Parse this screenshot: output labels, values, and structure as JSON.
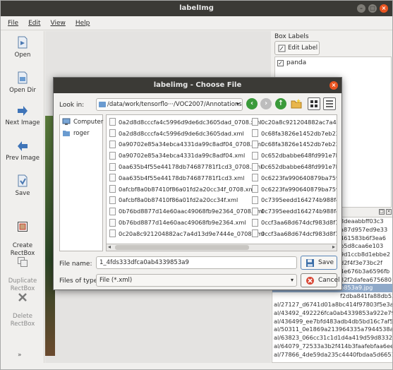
{
  "window": {
    "title": "labelImg"
  },
  "menu": {
    "items": [
      "File",
      "Edit",
      "View",
      "Help"
    ]
  },
  "toolbar": {
    "open": "Open",
    "open_dir": "Open Dir",
    "next_image": "Next Image",
    "prev_image": "Prev Image",
    "save": "Save",
    "create_rectbox": "Create\nRectBox",
    "duplicate_rectbox": "Duplicate\nRectBox",
    "delete_rectbox": "Delete\nRectBox",
    "more": "»"
  },
  "dock": {
    "title": "Box Labels",
    "edit_label": "Edit Label",
    "labels": [
      {
        "name": "panda",
        "checked": true
      }
    ],
    "file_list": [
      "8deaabbff03c3",
      "a87d957ed9e33",
      "461583b6f3ea6",
      "b5d8caa6e103",
      "9d1ccb8d1ebbe2",
      "d2f4f3e73bc2f",
      "4e676b3a6596fb",
      "32f2dafea675680",
      "b853a9.jpg",
      "f2dba841fa88db52",
      "al/27127_d6741d01a8bc414f97803f5e3a5",
      "al/43492_492226fca0ab4339853a922e79e",
      "al/436499_ee7bfd483adb4db5bd16c7af51",
      "al/50311_0e1869a213964335a7944538a8",
      "al/63823_066cc31c1d1d4a419d59d8332b",
      "al/64079_72533a3b2f414b3faafebfaa6ee",
      "al/77866_4de59da235c4440fbdaa5d6651"
    ],
    "selected_file_index": 8
  },
  "dialog": {
    "title": "labelimg - Choose File",
    "look_in_label": "Look in:",
    "look_in_value": "/data/work/tensorflo···/VOC2007/Annotations",
    "places": [
      "Computer",
      "roger"
    ],
    "files_col1": [
      "0a2d8d8cccfa4c5996d9de6dc3605dad_0708.xml",
      "0a2d8d8cccfa4c5996d9de6dc3605dad.xml",
      "0a90702e85a34ebca4331da99c8adf04_0708.xml",
      "0a90702e85a34ebca4331da99c8adf04.xml",
      "0aa635b4f55e44178db74687781f1cd3_0708.xml",
      "0aa635b4f55e44178db74687781f1cd3.xml",
      "0afcbf8a0b87410f86a01fd2a20cc34f_0708.xml",
      "0afcbf8a0b87410f86a01fd2a20cc34f.xml",
      "0b76bd8877d14e60aac49068fb9e2364_0708.xml",
      "0b76bd8877d14e60aac49068fb9e2364.xml",
      "0c20a8c921204882ac7a4d13d9e7444e_0708.xml"
    ],
    "files_col2": [
      "0c20a8c921204882ac7a4d1",
      "0c68fa3826e1452db7eb23f",
      "0c68fa3826e1452db7eb23f",
      "0c652dbabbe648fd991e7b5",
      "0c652dbabbe648fd991e7b5",
      "0c6223fa990640879ba7593",
      "0c6223fa990640879ba7593",
      "0c7395eedd164274b988f41",
      "0c7395eedd164274b988f41",
      "0ccf3aa68d674dcf983d8f1c",
      "0ccf3aa68d674dcf983d8f1c"
    ],
    "file_name_label": "File name:",
    "file_name_value": "1_4fds333dfca0ab4339853a9",
    "files_of_type_label": "Files of type:",
    "files_of_type_value": "File (*.xml)",
    "save_button": "Save",
    "cancel_button": "Cancel"
  },
  "colors": {
    "titlebar": "#3b3a36",
    "close": "#e95420",
    "nav_green": "#3a9a3a",
    "selection": "#8fa9c9"
  }
}
